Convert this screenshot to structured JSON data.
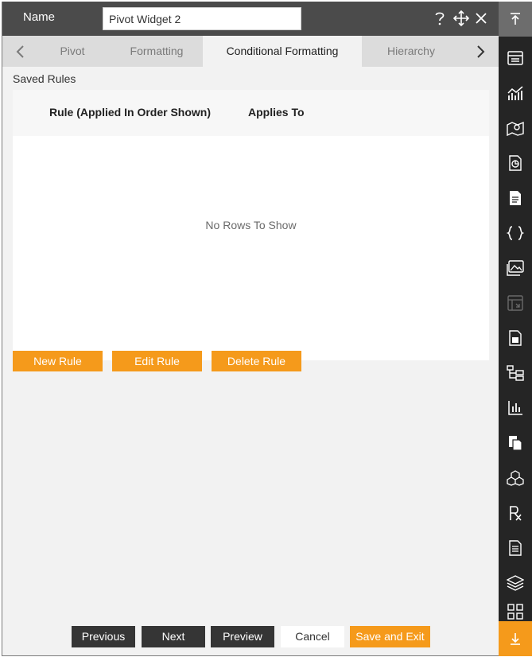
{
  "header": {
    "name_label": "Name",
    "name_value": "Pivot Widget 2",
    "icons": [
      "help-icon",
      "move-icon",
      "close-icon"
    ]
  },
  "tabs": [
    {
      "label": "Pivot",
      "active": false
    },
    {
      "label": "Formatting",
      "active": false
    },
    {
      "label": "Conditional Formatting",
      "active": true
    },
    {
      "label": "Hierarchy",
      "active": false
    }
  ],
  "saved_rules": {
    "label": "Saved Rules",
    "columns": [
      "Rule (Applied In Order Shown)",
      "Applies To"
    ],
    "empty_message": "No Rows To Show"
  },
  "rule_buttons": {
    "new": "New Rule",
    "edit": "Edit Rule",
    "delete": "Delete Rule"
  },
  "footer": {
    "previous": "Previous",
    "next": "Next",
    "preview": "Preview",
    "cancel": "Cancel",
    "save_exit": "Save and Exit"
  },
  "sidebar_icons": [
    "scroll-to-top-icon",
    "table-widget-icon",
    "chart-widget-icon",
    "map-widget-icon",
    "report-widget-icon",
    "document-widget-icon",
    "json-widget-icon",
    "image-widget-icon",
    "embed-widget-icon",
    "form-widget-icon",
    "tree-widget-icon",
    "kpi-widget-icon",
    "copy-widget-icon",
    "cube-widget-icon",
    "formula-widget-icon",
    "text-widget-icon",
    "layers-widget-icon",
    "grid-widget-icon",
    "scroll-to-bottom-icon"
  ],
  "colors": {
    "accent": "#f59a1b",
    "header": "#4b4b4b",
    "sidebar": "#252525",
    "dark_button": "#353535"
  }
}
